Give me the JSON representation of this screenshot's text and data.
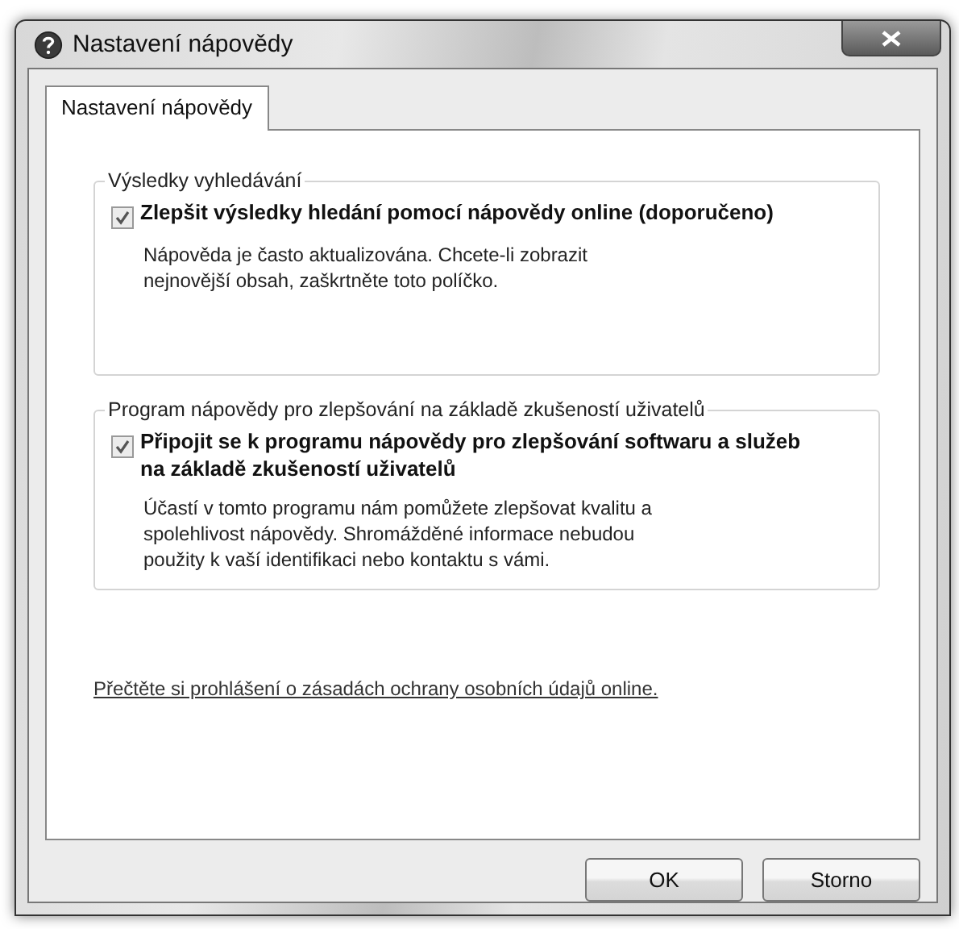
{
  "window": {
    "title": "Nastavení nápovědy"
  },
  "tabs": [
    {
      "label": "Nastavení nápovědy",
      "selected": true
    }
  ],
  "groups": [
    {
      "title": "Výsledky vyhledávání",
      "checkbox": {
        "label": "Zlepšit výsledky hledání pomocí nápovědy online (doporučeno)",
        "checked": true
      },
      "description": "Nápověda je často aktualizována. Chcete-li zobrazit nejnovější obsah, zaškrtněte toto políčko."
    },
    {
      "title": "Program nápovědy pro zlepšování na základě zkušeností uživatelů",
      "checkbox": {
        "label": "Připojit se k programu nápovědy pro zlepšování softwaru a služeb na základě zkušeností uživatelů",
        "checked": true
      },
      "description": "Účastí v tomto programu nám pomůžete zlepšovat kvalitu a spolehlivost nápovědy. Shromážděné informace nebudou použity k vaší identifikaci nebo kontaktu s vámi."
    }
  ],
  "privacy_link": "Přečtěte si prohlášení o zásadách ochrany osobních údajů online.",
  "buttons": [
    "OK",
    "Storno"
  ]
}
